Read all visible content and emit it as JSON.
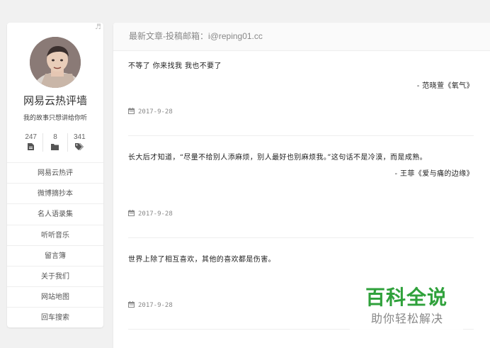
{
  "sidebar": {
    "music_note": "♬",
    "title": "网易云热评墙",
    "description": "我的故事只想讲给你听",
    "stats": [
      {
        "count": "247",
        "icon": "document-icon"
      },
      {
        "count": "8",
        "icon": "folder-icon"
      },
      {
        "count": "341",
        "icon": "tag-icon"
      }
    ],
    "nav": [
      "网易云热评",
      "微博摘抄本",
      "名人语录集",
      "听听音乐",
      "留言簿",
      "关于我们",
      "网站地图",
      "回车搜索"
    ]
  },
  "main": {
    "header": "最新文章-投稿邮箱：i@reping01.cc",
    "posts": [
      {
        "text": "不等了  你来找我  我也不要了",
        "source": "- 范晓萱《氧气》",
        "date": "2017-9-28"
      },
      {
        "text": "长大后才知道，“尽量不给别人添麻烦，别人最好也别麻烦我。”这句话不是冷漠，而是成熟。",
        "source": "- 王菲《爱与痛的边缘》",
        "date": "2017-9-28"
      },
      {
        "text": "世界上除了相互喜欢，其他的喜欢都是伤害。",
        "source": "",
        "date": "2017-9-28"
      }
    ]
  },
  "watermark": {
    "title": "百科全说",
    "subtitle": "助你轻松解决"
  },
  "colors": {
    "watermark_green": "#2fa13b",
    "page_bg": "#f1f1f1"
  }
}
